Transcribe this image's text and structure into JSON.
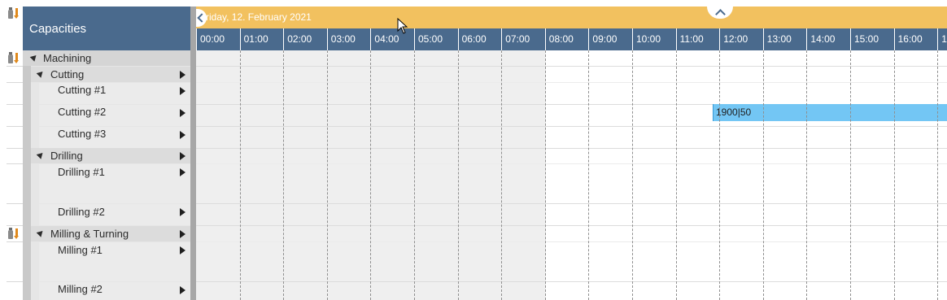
{
  "panel": {
    "title": "Capacities"
  },
  "date_bar": {
    "date": "riday, 12. February 2021"
  },
  "timeline": {
    "hours": [
      "00:00",
      "01:00",
      "02:00",
      "03:00",
      "04:00",
      "05:00",
      "06:00",
      "07:00",
      "08:00",
      "09:00",
      "10:00",
      "11:00",
      "12:00",
      "13:00",
      "14:00",
      "15:00",
      "16:00",
      "1"
    ]
  },
  "tree": {
    "root": "Machining",
    "groups": [
      {
        "label": "Cutting",
        "children": [
          "Cutting #1",
          "Cutting #2",
          "Cutting #3"
        ]
      },
      {
        "label": "Drilling",
        "children": [
          "Drilling #1",
          "Drilling #2"
        ]
      },
      {
        "label": "Milling & Turning",
        "children": [
          "Milling #1",
          "Milling #2"
        ]
      }
    ]
  },
  "orders": [
    {
      "label": "1900|50",
      "resource": "Cutting #2",
      "start_hour": "12:00"
    }
  ],
  "colors": {
    "header_blue": "#4a6a8d",
    "date_bar_orange": "#f2c15f",
    "order_blue": "#73c6f4",
    "non_working_gray": "#efefef"
  },
  "icons": [
    "capacity-sort-icon",
    "expand-triangle-icon",
    "play-arrow-icon",
    "chevron-left-icon",
    "chevron-up-icon"
  ]
}
